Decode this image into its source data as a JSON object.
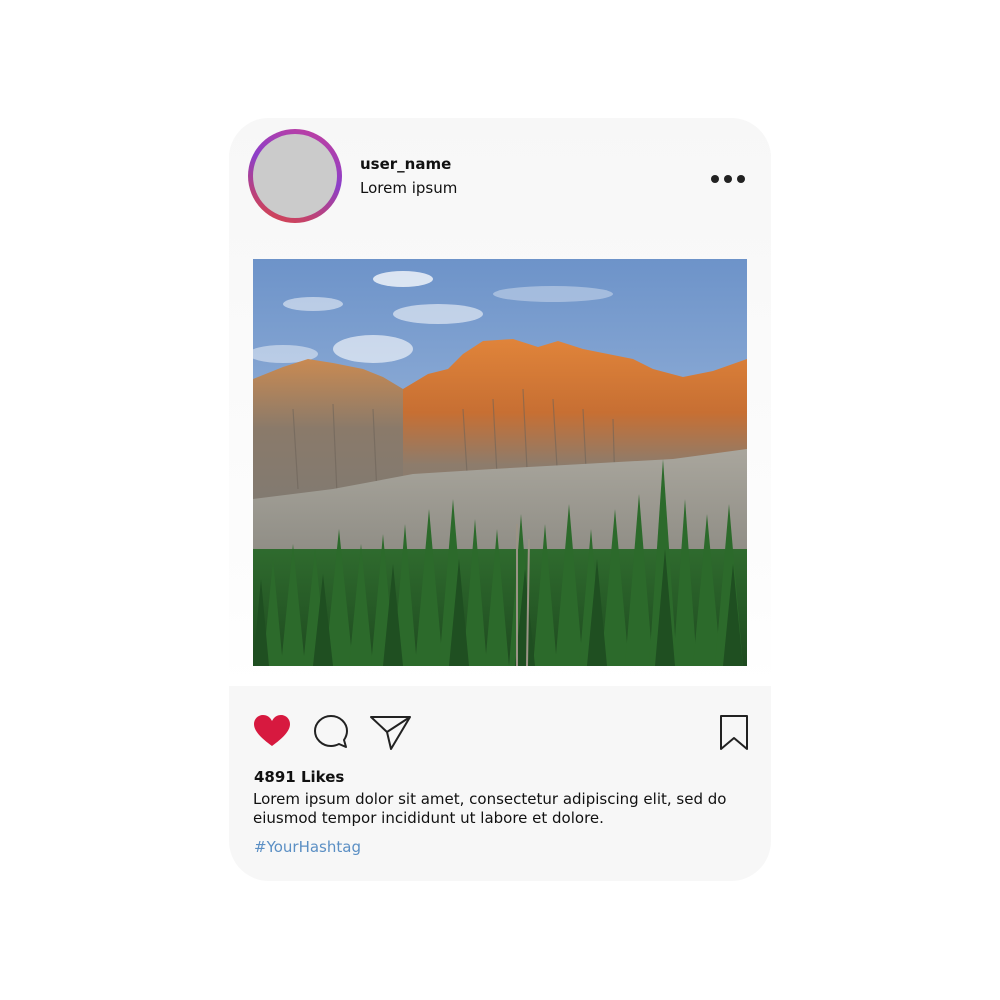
{
  "post": {
    "username": "user_name",
    "location": "Lorem ipsum",
    "likes": "4891 Likes",
    "caption": "Lorem ipsum dolor sit amet, consectetur adipiscing elit, sed do eiusmod tempor incididunt ut labore et dolore.",
    "hashtag": "#YourHashtag",
    "liked": true
  },
  "icons": {
    "more": "more-options-icon",
    "like": "heart-icon",
    "comment": "comment-icon",
    "share": "send-icon",
    "save": "bookmark-icon"
  },
  "colors": {
    "heart": "#d7193f",
    "hashtag": "#5b8fc4",
    "avatar_ring_start": "#e0443c",
    "avatar_ring_end": "#8c3fc9"
  }
}
